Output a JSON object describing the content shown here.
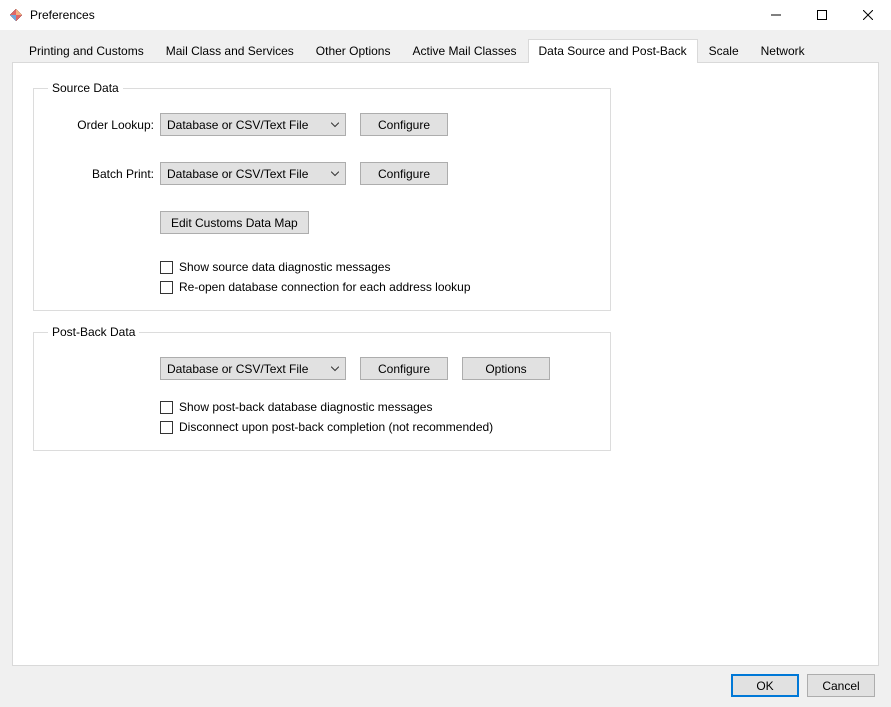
{
  "window": {
    "title": "Preferences"
  },
  "tabs": [
    {
      "label": "Printing and Customs"
    },
    {
      "label": "Mail Class and Services"
    },
    {
      "label": "Other Options"
    },
    {
      "label": "Active Mail Classes"
    },
    {
      "label": "Data Source and Post-Back"
    },
    {
      "label": "Scale"
    },
    {
      "label": "Network"
    }
  ],
  "active_tab_index": 4,
  "source_data": {
    "legend": "Source Data",
    "order_lookup_label": "Order Lookup:",
    "order_lookup_value": "Database or CSV/Text File",
    "batch_print_label": "Batch Print:",
    "batch_print_value": "Database or CSV/Text File",
    "configure_label": "Configure",
    "edit_map_label": "Edit Customs Data Map",
    "chk_diag": "Show source data diagnostic messages",
    "chk_reopen": "Re-open database connection for each address lookup"
  },
  "post_back": {
    "legend": "Post-Back Data",
    "combo_value": "Database or CSV/Text File",
    "configure_label": "Configure",
    "options_label": "Options",
    "chk_diag": "Show post-back database diagnostic messages",
    "chk_disconnect": "Disconnect upon post-back completion (not recommended)"
  },
  "footer": {
    "ok": "OK",
    "cancel": "Cancel"
  }
}
